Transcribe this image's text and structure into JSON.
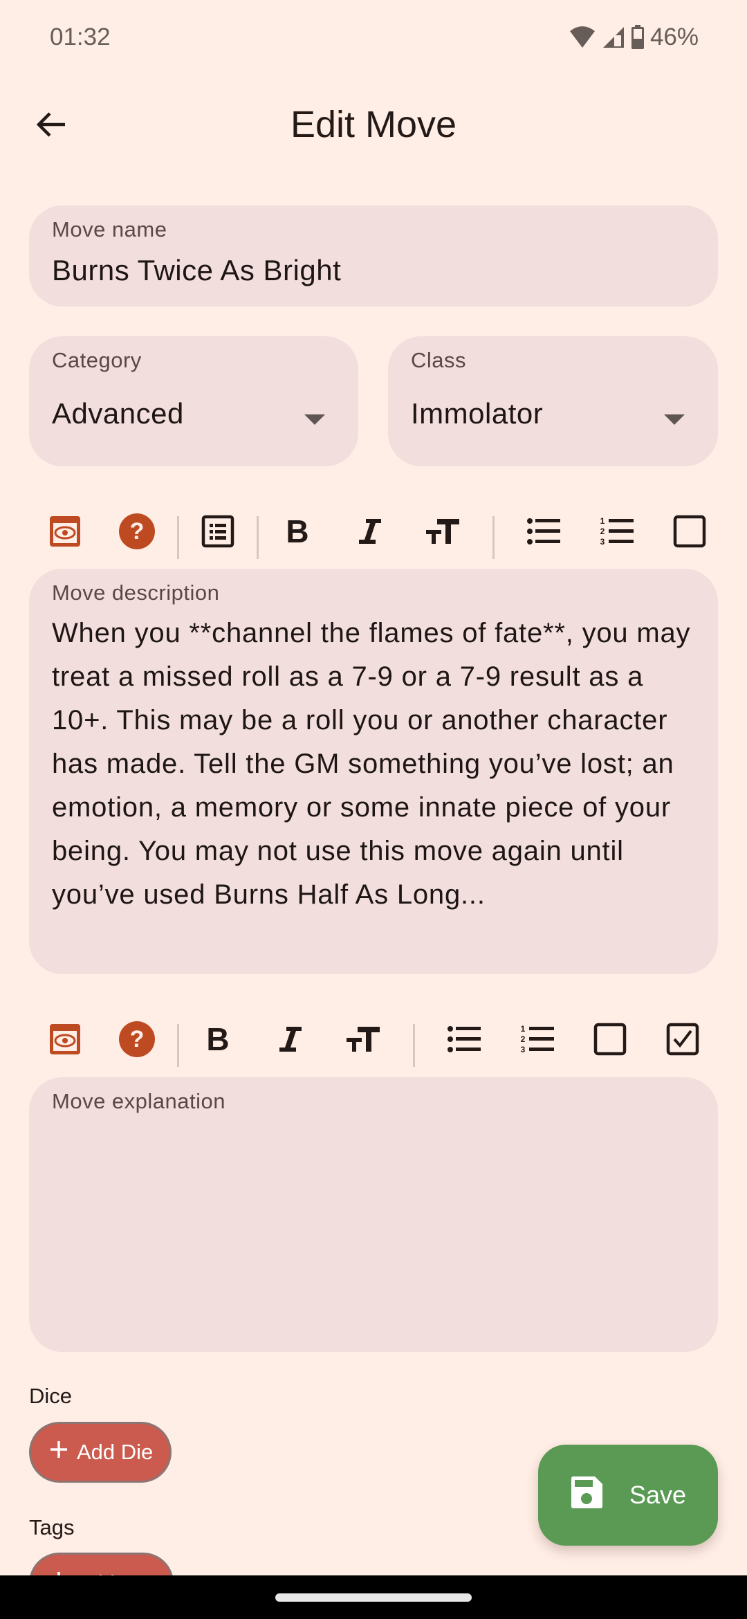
{
  "status_bar": {
    "time": "01:32",
    "battery_percent": "46%",
    "icons": [
      "wifi-icon",
      "cell-signal-icon",
      "battery-icon"
    ]
  },
  "app_bar": {
    "title": "Edit Move",
    "back_icon": "arrow-left-icon"
  },
  "form": {
    "move_name": {
      "label": "Move name",
      "value": "Burns Twice As Bright"
    },
    "category": {
      "label": "Category",
      "value": "Advanced"
    },
    "class": {
      "label": "Class",
      "value": "Immolator"
    },
    "description_toolbar": [
      "preview",
      "help",
      "details-list",
      "bold",
      "italic",
      "text-size",
      "bulleted-list",
      "numbered-list",
      "checkbox-empty"
    ],
    "description": {
      "label": "Move description",
      "value": "When you **channel the flames of fate**, you may treat a missed roll as a 7-9 or a 7-9 result as a 10+. This may be a roll you or another character has made. Tell the GM something you’ve lost; an emotion, a memory or some innate piece of your being. You may not use this move again until you’ve used Burns Half As Long..."
    },
    "explanation_toolbar": [
      "preview",
      "help",
      "bold",
      "italic",
      "text-size",
      "bulleted-list",
      "numbered-list",
      "checkbox-empty",
      "checkbox-checked"
    ],
    "explanation": {
      "label": "Move explanation",
      "value": ""
    },
    "dice": {
      "label": "Dice",
      "button": "Add Die"
    },
    "tags": {
      "label": "Tags",
      "button": "Add Tag"
    }
  },
  "fab": {
    "label": "Save",
    "icon": "floppy-disk-icon"
  },
  "colors": {
    "background": "#FFEEE6",
    "field": "#F2DEDD",
    "accent_orange": "#BE4A22",
    "chip_red": "#CA5B4E",
    "fab_green": "#5A9A54"
  }
}
